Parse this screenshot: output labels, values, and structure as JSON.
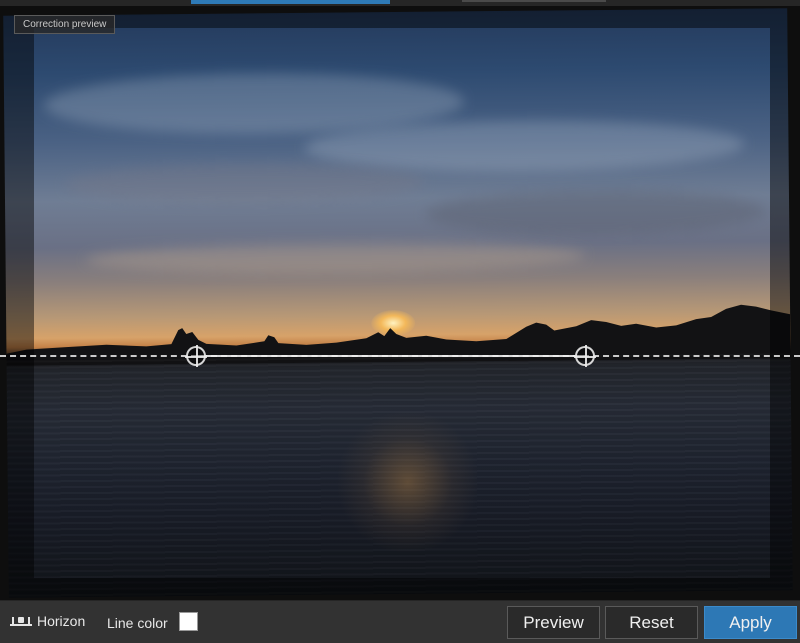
{
  "canvas": {
    "preview_label": "Correction preview"
  },
  "toolbar": {
    "horizon_label": "Horizon",
    "horizon_icon": "horizon-level-icon",
    "line_color_label": "Line color",
    "line_color_value": "#ffffff",
    "preview_label": "Preview",
    "reset_label": "Reset",
    "apply_label": "Apply"
  },
  "colors": {
    "accent": "#2d78b5",
    "toolbar_bg": "#323232"
  }
}
